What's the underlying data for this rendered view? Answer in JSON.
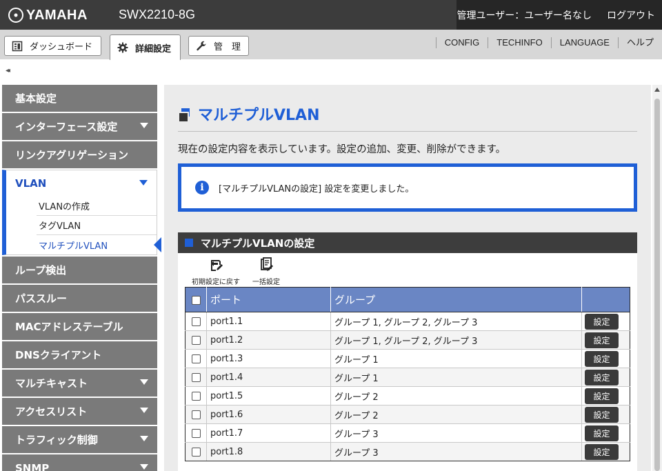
{
  "header": {
    "brand": "YAMAHA",
    "model": "SWX2210-8G",
    "user_status": "管理ユーザー：ユーザー名なし",
    "logout": "ログアウト"
  },
  "tabs": [
    {
      "label": "ダッシュボード",
      "icon": "dashboard-icon"
    },
    {
      "label": "詳細設定",
      "icon": "gear-icon"
    },
    {
      "label": "管　理",
      "icon": "wrench-icon"
    }
  ],
  "toplinks": [
    "CONFIG",
    "TECHINFO",
    "LANGUAGE",
    "ヘルプ"
  ],
  "collapse_glyph": "◂◂",
  "sidebar": {
    "items": [
      {
        "label": "基本設定",
        "has_submenu": false
      },
      {
        "label": "インターフェース設定",
        "has_submenu": true
      },
      {
        "label": "リンクアグリゲーション",
        "has_submenu": false
      },
      {
        "label": "VLAN",
        "has_submenu": true,
        "active": true
      },
      {
        "label": "ループ検出",
        "has_submenu": false
      },
      {
        "label": "パススルー",
        "has_submenu": false
      },
      {
        "label": "MACアドレステーブル",
        "has_submenu": false
      },
      {
        "label": "DNSクライアント",
        "has_submenu": false
      },
      {
        "label": "マルチキャスト",
        "has_submenu": true
      },
      {
        "label": "アクセスリスト",
        "has_submenu": true
      },
      {
        "label": "トラフィック制御",
        "has_submenu": true
      },
      {
        "label": "SNMP",
        "has_submenu": true
      }
    ],
    "vlan_submenu": [
      "VLANの作成",
      "タグVLAN",
      "マルチプルVLAN"
    ],
    "current_submenu": "マルチプルVLAN"
  },
  "main": {
    "title": "マルチプルVLAN",
    "description": "現在の設定内容を表示しています。設定の追加、変更、削除ができます。",
    "notice": "[マルチプルVLANの設定] 設定を変更しました。",
    "section_title": "マルチプルVLANの設定",
    "tools": {
      "reset_label": "初期設定に戻す",
      "bulk_label": "一括設定"
    },
    "table": {
      "columns": [
        "ポート",
        "グループ"
      ],
      "button_label": "設定",
      "rows": [
        {
          "port": "port1.1",
          "group": "グループ 1, グループ 2, グループ 3"
        },
        {
          "port": "port1.2",
          "group": "グループ 1, グループ 2, グループ 3"
        },
        {
          "port": "port1.3",
          "group": "グループ 1"
        },
        {
          "port": "port1.4",
          "group": "グループ 1"
        },
        {
          "port": "port1.5",
          "group": "グループ 2"
        },
        {
          "port": "port1.6",
          "group": "グループ 2"
        },
        {
          "port": "port1.7",
          "group": "グループ 3"
        },
        {
          "port": "port1.8",
          "group": "グループ 3"
        }
      ]
    }
  },
  "colors": {
    "accent": "#1f5fd6",
    "header_bg": "#3c3c3c",
    "sidebar_bg": "#7a7a7a",
    "table_header": "#6a86c4"
  }
}
